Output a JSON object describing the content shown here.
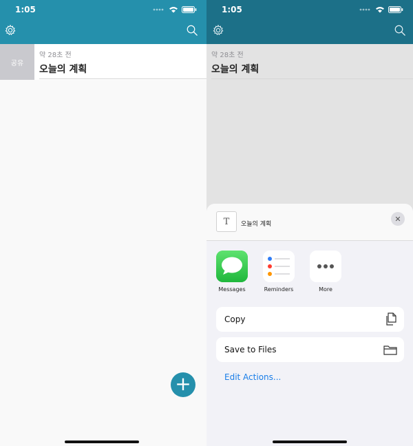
{
  "status": {
    "time": "1:05"
  },
  "icons": {
    "settings": "gear-icon",
    "search": "search-icon",
    "add": "plus-icon",
    "close": "close-icon",
    "copy": "copy-icon",
    "save": "folder-icon"
  },
  "colors": {
    "brand": "#2590ac",
    "accent_link": "#1a7ee8",
    "swipe_action": "#c9c9ce"
  },
  "swipe_action": {
    "label": "공유"
  },
  "note": {
    "timestamp": "약 28초 전",
    "title": "오늘의 계획"
  },
  "fab": {
    "glyph": "+"
  },
  "share_sheet": {
    "item_title": "오늘의 계획",
    "item_glyph": "T",
    "close_glyph": "✕",
    "apps": [
      {
        "label": "Messages"
      },
      {
        "label": "Reminders"
      },
      {
        "label": "More"
      }
    ],
    "actions": [
      {
        "label": "Copy"
      },
      {
        "label": "Save to Files"
      }
    ],
    "edit_actions": "Edit Actions..."
  }
}
